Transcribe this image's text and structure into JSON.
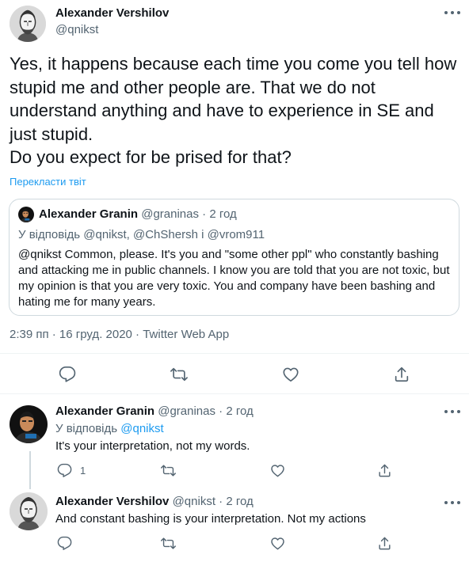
{
  "main_tweet": {
    "author_name": "Alexander Vershilov",
    "author_handle": "@qnikst",
    "text_lines": [
      "Yes, it happens because each time you come you tell how stupid me and other people are. That we do not understand anything and have to experience in SE and just stupid.",
      "Do you expect for be prised for that?"
    ],
    "translate_label": "Перекласти твіт",
    "timestamp": "2:39 пп · 16 груд. 2020 · Twitter Web App"
  },
  "quoted_tweet": {
    "author_name": "Alexander Granin",
    "author_handle": "@graninas",
    "time": "· 2 год",
    "reply_to": "У відповідь @qnikst, @ChShersh і @vrom911",
    "text": "@qnikst Common, please. It's you and \"some other ppl\" who constantly bashing and attacking me in public channels. I know you are told that you are not toxic, but my opinion is that you are very toxic. You and company have been bashing and hating me for many years."
  },
  "replies": [
    {
      "author_name": "Alexander Granin",
      "author_handle": "@graninas",
      "time": "· 2 год",
      "reply_prefix": "У відповідь",
      "reply_mention": "@qnikst",
      "text": "It's your interpretation, not my words.",
      "reply_count": "1"
    },
    {
      "author_name": "Alexander Vershilov",
      "author_handle": "@qnikst",
      "time": "· 2 год",
      "text": "And constant bashing is your interpretation. Not my actions",
      "reply_count": ""
    }
  ],
  "icons": {
    "reply": "reply-icon",
    "retweet": "retweet-icon",
    "like": "like-icon",
    "share": "share-icon",
    "more": "more-icon"
  },
  "colors": {
    "text": "#0f1419",
    "secondary": "#536471",
    "link": "#1d9bf0",
    "border": "#cfd9de"
  }
}
